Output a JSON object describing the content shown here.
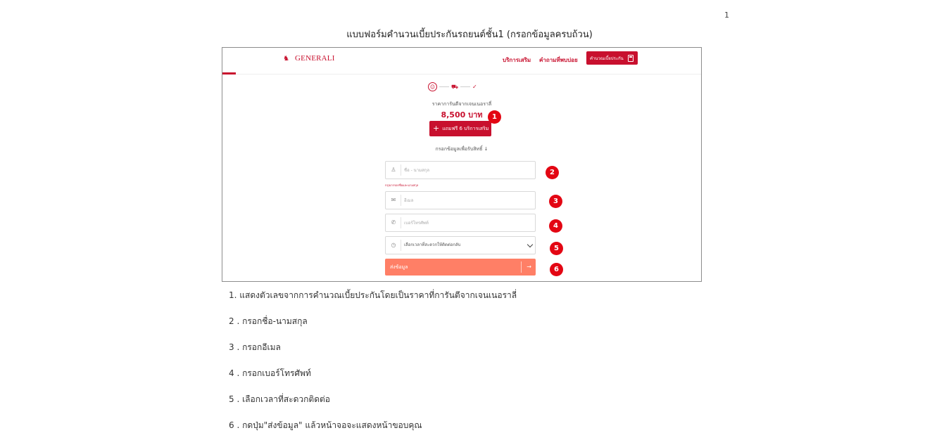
{
  "page_number": "1",
  "doc_title": "แบบฟอร์มคำนวนเบี้ยประกันรถยนต์ชั้น1 (กรอกข้อมูลครบถ้วน)",
  "screenshot": {
    "logo_text": "GENERALI",
    "nav": {
      "link_services": "บริการเสริม",
      "link_faq": "คำถามที่พบบ่อย",
      "cta_label": "คำนวณเบี้ยประกัน"
    },
    "price_label": "ราคาการันตีจากเจนเนอราลี่",
    "price_value": "8,500 บาท",
    "free_services_label": "แถมฟรี 6 บริการเสริม",
    "fill_hint": "กรอกข้อมูลเพื่อรับสิทธิ์ ↓",
    "form": {
      "name_placeholder": "ชื่อ - นามสกุล",
      "name_error": "กรุณากรอกชื่อและนามสกุล",
      "email_placeholder": "อีเมล",
      "phone_placeholder": "เบอร์โทรศัพท์",
      "time_select_value": "เลือกเวลาที่สะดวกให้ติดต่อกลับ",
      "submit_label": "ส่งข้อมูล"
    },
    "badges": [
      "1",
      "2",
      "3",
      "4",
      "5",
      "6"
    ],
    "icons": [
      "user-icon",
      "car-icon",
      "check-icon",
      "calculator-icon",
      "mail-icon",
      "phone-icon",
      "clock-icon",
      "chevron-down-icon",
      "arrow-right-icon"
    ],
    "colors": {
      "brand_red": "#c8102e",
      "badge_red": "#e30613",
      "submit_salmon": "#ff7f66"
    }
  },
  "instructions": [
    "1. แสดงตัวเลขจากการคำนวณเบี้ยประกันโดยเป็นราคาที่การันตีจากเจนเนอราลี่",
    "2 . กรอกชื่อ-นามสกุล",
    "3 . กรอกอีเมล",
    "4 . กรอกเบอร์โทรศัพท์",
    "5 . เลือกเวลาที่สะดวกติดต่อ",
    "6 . กดปุ่ม\"ส่งข้อมูล\" แล้วหน้าจอจะแสดงหน้าขอบคุณ"
  ]
}
